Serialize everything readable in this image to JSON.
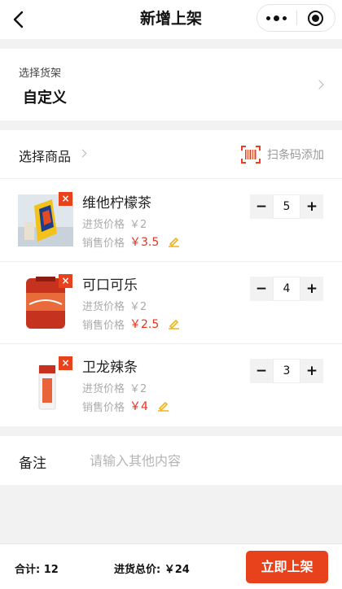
{
  "nav": {
    "title": "新增上架",
    "back_icon": "chevron-left-icon",
    "more_icon": "more-dots-icon",
    "close_icon": "target-close-icon"
  },
  "shelf": {
    "label": "选择货架",
    "value": "自定义"
  },
  "goods": {
    "title": "选择商品",
    "scan_label": "扫条码添加",
    "scan_icon": "barcode-scan-icon",
    "cost_label": "进货价格",
    "sale_label": "销售价格",
    "items": [
      {
        "name": "维他柠檬茶",
        "cost": "￥2",
        "sale": "￥3.5",
        "qty": "5",
        "minus": "−",
        "plus": "+",
        "remove": "×"
      },
      {
        "name": "可口可乐",
        "cost": "￥2",
        "sale": "￥2.5",
        "qty": "4",
        "minus": "−",
        "plus": "+",
        "remove": "×"
      },
      {
        "name": "卫龙辣条",
        "cost": "￥2",
        "sale": "￥4",
        "qty": "3",
        "minus": "−",
        "plus": "+",
        "remove": "×"
      }
    ]
  },
  "note": {
    "label": "备注",
    "placeholder": "请输入其他内容",
    "value": ""
  },
  "footer": {
    "total": "合计: 12",
    "cost_total": "进货总价: ￥24",
    "submit": "立即上架"
  },
  "colors": {
    "accent": "#e8421d",
    "price": "#e8321d",
    "edit": "#f0b21c"
  }
}
